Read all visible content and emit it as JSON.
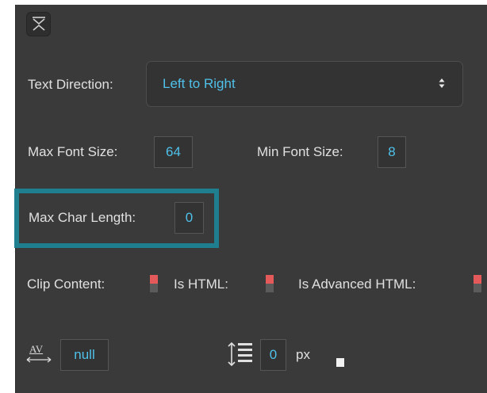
{
  "text_direction": {
    "label": "Text Direction:",
    "value": "Left to Right"
  },
  "max_font_size": {
    "label": "Max Font Size:",
    "value": "64"
  },
  "min_font_size": {
    "label": "Min Font Size:",
    "value": "8"
  },
  "max_char_length": {
    "label": "Max Char Length:",
    "value": "0"
  },
  "toggles": {
    "clip_content": "Clip Content:",
    "is_html": "Is HTML:",
    "is_advanced_html": "Is Advanced HTML:"
  },
  "letter_spacing": {
    "icon_text": "AV",
    "value": "null"
  },
  "line_height": {
    "value": "0",
    "unit": "px"
  },
  "colors": {
    "panel": "#3a3a3a",
    "accent_text": "#4fc1ea",
    "highlight": "#1f7f8f",
    "toggle_on": "#e45a5a"
  }
}
